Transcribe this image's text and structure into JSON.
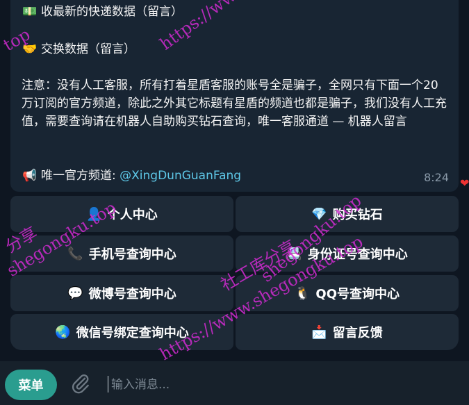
{
  "message": {
    "line1_icon": "money-bag-icon",
    "line1": "收最新的快递数据（留言）",
    "line2_icon": "handshake-icon",
    "line2": "交换数据（留言）",
    "notice": "注意：没有人工客服，所有打着星盾客服的账号全是骗子，全网只有下面一个20万订阅的官方频道，除此之外其它标题有星盾的频道也都是骗子，我们没有人工充值，需要查询请在机器人自助购买钻石查询，唯一客服通道 — 机器人留言",
    "channel_icon": "megaphone-icon",
    "channel_label": "唯一官方频道: ",
    "channel_link": "@XingDunGuanFang",
    "time": "8:24"
  },
  "keyboard": {
    "buttons": [
      {
        "icon": "user-icon",
        "glyph": "👤",
        "label": "个人中心"
      },
      {
        "icon": "diamond-icon",
        "glyph": "💎",
        "label": "购买钻石"
      },
      {
        "icon": "phone-icon",
        "glyph": "📞",
        "label": "手机号查询中心"
      },
      {
        "icon": "id-card-icon",
        "glyph": "📇",
        "label": "身份证号查询中心"
      },
      {
        "icon": "speech-bubble-icon",
        "glyph": "💬",
        "label": "微博号查询中心"
      },
      {
        "icon": "penguin-icon",
        "glyph": "🐧",
        "label": "QQ号查询中心"
      },
      {
        "icon": "globe-icon",
        "glyph": "🌏",
        "label": "微信号绑定查询中心"
      },
      {
        "icon": "inbox-icon",
        "glyph": "📩",
        "label": "留言反馈"
      }
    ]
  },
  "watermark": {
    "url": "https://www.shegongku.top",
    "text1": "社工库分享",
    "text2": "shegongku.top",
    "text3": "分享",
    "text4": "top"
  },
  "input": {
    "menu_label": "菜单",
    "placeholder": "输入消息..."
  },
  "colors": {
    "background": "#0e1621",
    "bubble": "#182533",
    "button": "#1e2a37",
    "menu_button": "#2a9d8f",
    "link": "#5ec8e8",
    "watermark": "#d12ad1"
  }
}
